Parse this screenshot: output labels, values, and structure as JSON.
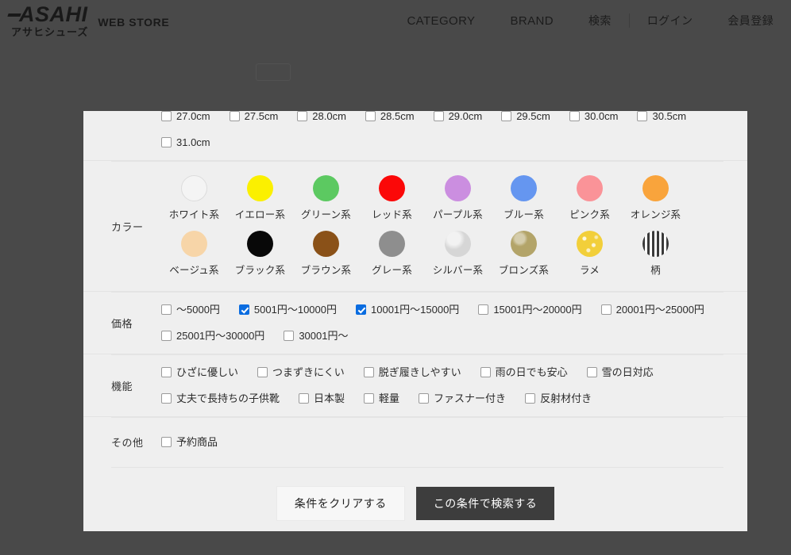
{
  "header": {
    "logo_main": "ASAHI",
    "logo_kana": "アサヒシューズ",
    "logo_sub": "WEB STORE",
    "nav": [
      {
        "label": "CATEGORY",
        "type": "en"
      },
      {
        "label": "BRAND",
        "type": "en"
      },
      {
        "label": "検索",
        "type": "jp"
      },
      {
        "label": "ログイン",
        "type": "jp"
      },
      {
        "label": "会員登録",
        "type": "jp"
      }
    ]
  },
  "modal": {
    "sections": {
      "size": {
        "label": "",
        "row1": [
          {
            "label": "27.0cm",
            "checked": false
          },
          {
            "label": "27.5cm",
            "checked": false
          },
          {
            "label": "28.0cm",
            "checked": false
          },
          {
            "label": "28.5cm",
            "checked": false
          },
          {
            "label": "29.0cm",
            "checked": false
          },
          {
            "label": "29.5cm",
            "checked": false
          },
          {
            "label": "30.0cm",
            "checked": false
          },
          {
            "label": "30.5cm",
            "checked": false
          }
        ],
        "row2": [
          {
            "label": "31.0cm",
            "checked": false
          }
        ]
      },
      "color": {
        "label": "カラー",
        "row1": [
          {
            "label": "ホワイト系",
            "color": "#f4f4f4",
            "style": "ring"
          },
          {
            "label": "イエロー系",
            "color": "#fbf000",
            "style": "flat"
          },
          {
            "label": "グリーン系",
            "color": "#5cc961",
            "style": "flat"
          },
          {
            "label": "レッド系",
            "color": "#fb0808",
            "style": "flat"
          },
          {
            "label": "パープル系",
            "color": "#cb8ee0",
            "style": "flat"
          },
          {
            "label": "ブルー系",
            "color": "#6596f0",
            "style": "flat"
          },
          {
            "label": "ピンク系",
            "color": "#fa9398",
            "style": "flat"
          },
          {
            "label": "オレンジ系",
            "color": "#f9a43c",
            "style": "flat"
          }
        ],
        "row2": [
          {
            "label": "ベージュ系",
            "color": "#f7d5a8",
            "style": "flat"
          },
          {
            "label": "ブラック系",
            "color": "#080808",
            "style": "flat"
          },
          {
            "label": "ブラウン系",
            "color": "#8a5118",
            "style": "flat"
          },
          {
            "label": "グレー系",
            "color": "#8e8e8e",
            "style": "flat"
          },
          {
            "label": "シルバー系",
            "color": "#d6d6d6",
            "style": "silver"
          },
          {
            "label": "ブロンズ系",
            "color": "#b3a469",
            "style": "bronze"
          },
          {
            "label": "ラメ",
            "color": "#f2cf3a",
            "style": "glitter"
          },
          {
            "label": "柄",
            "color": "#3a3a3a",
            "style": "pattern"
          }
        ]
      },
      "price": {
        "label": "価格",
        "row1": [
          {
            "label": "〜5000円",
            "checked": false
          },
          {
            "label": "5001円〜10000円",
            "checked": true
          },
          {
            "label": "10001円〜15000円",
            "checked": true
          },
          {
            "label": "15001円〜20000円",
            "checked": false
          },
          {
            "label": "20001円〜25000円",
            "checked": false
          }
        ],
        "row2": [
          {
            "label": "25001円〜30000円",
            "checked": false
          },
          {
            "label": "30001円〜",
            "checked": false
          }
        ]
      },
      "function": {
        "label": "機能",
        "row1": [
          {
            "label": "ひざに優しい",
            "checked": false
          },
          {
            "label": "つまずきにくい",
            "checked": false
          },
          {
            "label": "脱ぎ履きしやすい",
            "checked": false
          },
          {
            "label": "雨の日でも安心",
            "checked": false
          },
          {
            "label": "雪の日対応",
            "checked": false
          }
        ],
        "row2": [
          {
            "label": "丈夫で長持ちの子供靴",
            "checked": false
          },
          {
            "label": "日本製",
            "checked": false
          },
          {
            "label": "軽量",
            "checked": false
          },
          {
            "label": "ファスナー付き",
            "checked": false
          },
          {
            "label": "反射材付き",
            "checked": false
          }
        ]
      },
      "other": {
        "label": "その他",
        "row1": [
          {
            "label": "予約商品",
            "checked": false
          }
        ]
      }
    },
    "actions": {
      "clear_label": "条件をクリアする",
      "search_label": "この条件で検索する"
    }
  },
  "colors": {
    "overlay": "#1c1c1c",
    "modal_bg": "#efefef",
    "checked_accent": "#0a6ce0",
    "search_button_bg": "#3d3d3d",
    "clear_button_bg": "#f7f7f7"
  }
}
